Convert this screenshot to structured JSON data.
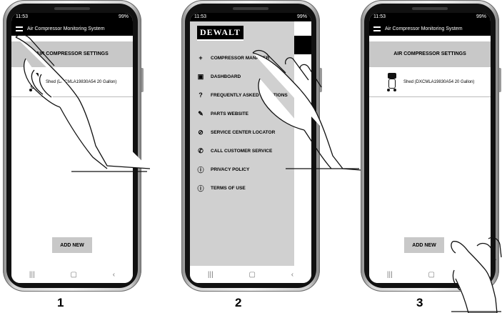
{
  "phones": [
    {
      "status": {
        "time": "11:53",
        "battery": "99%"
      },
      "app_title": "Air Compressor Monitoring System",
      "section_title": "AIR COMPRESSOR SETTINGS",
      "device_name": "Shed (DXCMLA19830A54 20 Gallon)",
      "add_new": "ADD NEW",
      "step_label": "1"
    },
    {
      "status": {
        "time": "11:53",
        "battery": "99%"
      },
      "brand": "DEWALT",
      "menu": [
        {
          "icon": "plus-icon",
          "label": "COMPRESSOR MANAGER"
        },
        {
          "icon": "dashboard-icon",
          "label": "DASHBOARD"
        },
        {
          "icon": "question-icon",
          "label": "FREQUENTLY ASKED QUESTIONS"
        },
        {
          "icon": "wrench-icon",
          "label": "PARTS WEBSITE"
        },
        {
          "icon": "compass-icon",
          "label": "SERVICE CENTER LOCATOR"
        },
        {
          "icon": "phone-icon",
          "label": "CALL CUSTOMER SERVICE"
        },
        {
          "icon": "info-icon",
          "label": "PRIVACY POLICY"
        },
        {
          "icon": "info-icon",
          "label": "TERMS OF USE"
        }
      ],
      "step_label": "2"
    },
    {
      "status": {
        "time": "11:53",
        "battery": "99%"
      },
      "app_title": "Air Compressor Monitoring System",
      "section_title": "AIR COMPRESSOR SETTINGS",
      "device_name": "Shed (DXCMLA19830A54 20 Gallon)",
      "add_new": "ADD NEW",
      "step_label": "3"
    }
  ],
  "nav_icons": [
    "recents-icon",
    "home-icon",
    "back-icon"
  ]
}
